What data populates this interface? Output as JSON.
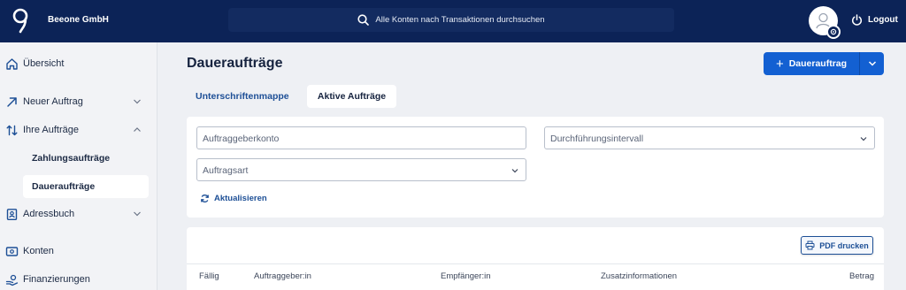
{
  "header": {
    "company": "Beeone GmbH",
    "search_placeholder": "Alle Konten nach Transaktionen durchsuchen",
    "logout": "Logout"
  },
  "sidebar": {
    "items": [
      {
        "label": "Übersicht",
        "icon": "home-icon"
      },
      {
        "label": "Neuer Auftrag",
        "icon": "arrow-up-right-icon"
      },
      {
        "label": "Ihre Aufträge",
        "icon": "transfer-arrows-icon"
      },
      {
        "label": "Adressbuch",
        "icon": "contact-book-icon"
      },
      {
        "label": "Konten",
        "icon": "bank-card-icon"
      },
      {
        "label": "Finanzierungen",
        "icon": "financing-icon"
      }
    ],
    "subitems": [
      {
        "label": "Zahlungsaufträge"
      },
      {
        "label": "Daueraufträge",
        "active": true
      }
    ]
  },
  "main": {
    "title": "Daueraufträge",
    "primary_button": "Dauerauftrag",
    "tabs": [
      {
        "label": "Unterschriftenmappe",
        "active": false
      },
      {
        "label": "Aktive Aufträge",
        "active": true
      }
    ],
    "filters": {
      "account": "Auftraggeberkonto",
      "interval": "Durchführungsintervall",
      "type": "Auftragsart"
    },
    "refresh": "Aktualisieren",
    "pdf_button": "PDF drucken",
    "columns": [
      "Fällig",
      "Auftraggeber:in",
      "Empfänger:in",
      "Zusatzinformationen",
      "Betrag"
    ]
  },
  "colors": {
    "header_bg": "#0c2357",
    "accent": "#1360d2",
    "link": "#1d4f96"
  }
}
